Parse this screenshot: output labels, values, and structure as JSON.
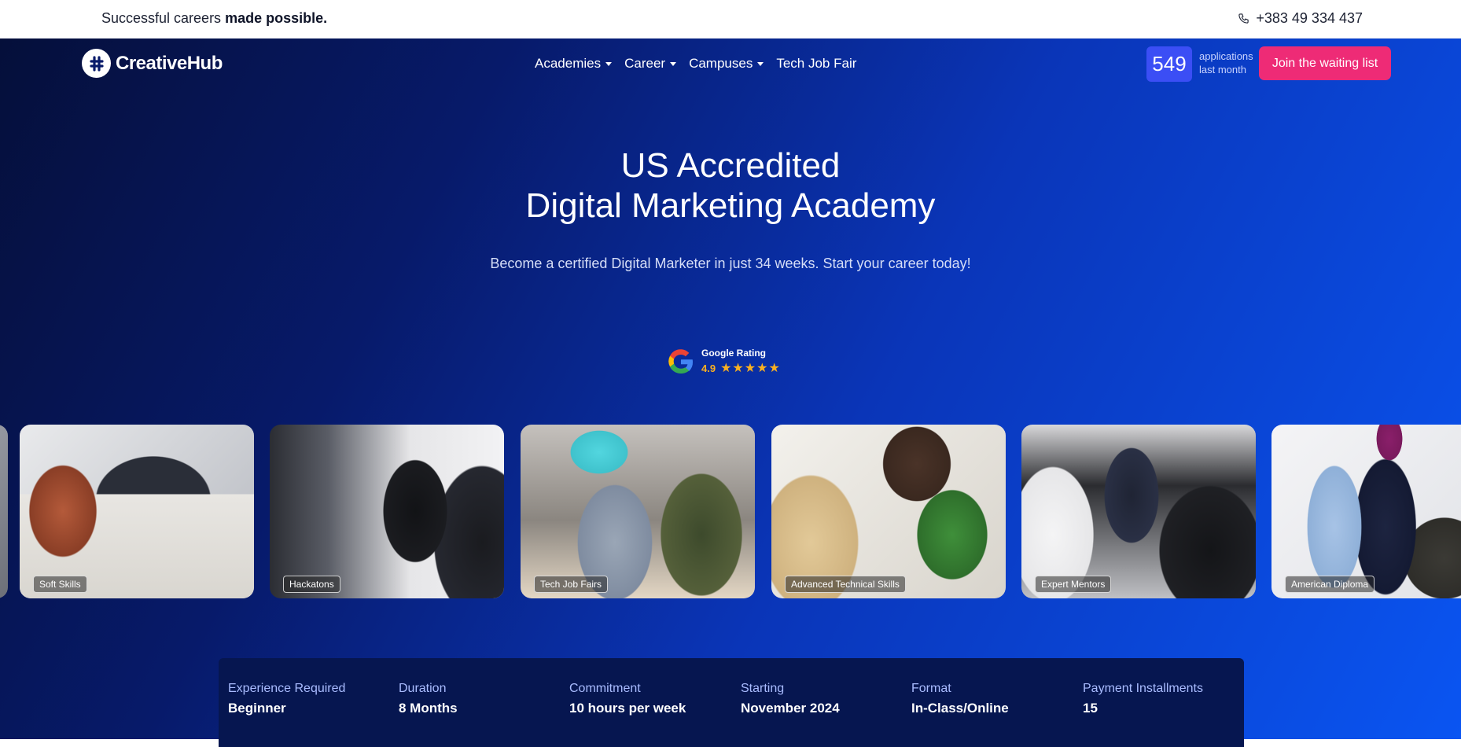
{
  "topbar": {
    "tagline_prefix": "Successful careers",
    "tagline_bold": "made possible.",
    "phone": "+383 49 334 437"
  },
  "brand": {
    "name": "CreativeHub",
    "mark": "#"
  },
  "nav": {
    "items": [
      {
        "label": "Academies",
        "dropdown": true
      },
      {
        "label": "Career",
        "dropdown": true
      },
      {
        "label": "Campuses",
        "dropdown": true
      },
      {
        "label": "Tech Job Fair",
        "dropdown": false
      }
    ]
  },
  "stats": {
    "count": "549",
    "label_line1": "applications",
    "label_line2": "last month"
  },
  "cta": {
    "label": "Join the waiting list"
  },
  "hero": {
    "title_line1": "US Accredited",
    "title_line2": "Digital Marketing Academy",
    "subtitle": "Become a certified Digital Marketer in just 34 weeks. Start your career today!"
  },
  "rating": {
    "label": "Google Rating",
    "score": "4.9",
    "stars": "★★★★★"
  },
  "cards": [
    {
      "label": "Soft Skills"
    },
    {
      "label": "Hackatons"
    },
    {
      "label": "Tech Job Fairs"
    },
    {
      "label": "Advanced Technical Skills"
    },
    {
      "label": "Expert Mentors"
    },
    {
      "label": "American Diploma"
    }
  ],
  "details": [
    {
      "label": "Experience Required",
      "value": "Beginner"
    },
    {
      "label": "Duration",
      "value": "8 Months"
    },
    {
      "label": "Commitment",
      "value": "10 hours per week"
    },
    {
      "label": "Starting",
      "value": "November 2024"
    },
    {
      "label": "Format",
      "value": "In-Class/Online"
    },
    {
      "label": "Payment Installments",
      "value": "15"
    }
  ],
  "colors": {
    "accent_pink": "#ee2b76",
    "counter_blue": "#3b4ef5",
    "star_gold": "#f9b021"
  }
}
